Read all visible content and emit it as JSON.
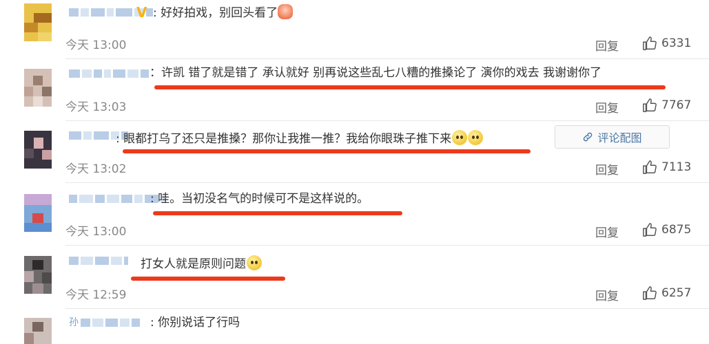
{
  "colors": {
    "underline": "#ee3a1c",
    "link": "#4c77a8",
    "vip": "#f6b417"
  },
  "reply_label": "回复",
  "comments": [
    {
      "text": ":  好好拍戏，别回头看了",
      "time": "今天 13:00",
      "likes": "6331",
      "vip": "V"
    },
    {
      "text": "：许凯 错了就是错了 承认就好 别再说这些乱七八糟的推搡论了 演你的戏去 我谢谢你了",
      "time": "今天 13:03",
      "likes": "7767"
    },
    {
      "text": ":  眼都打乌了还只是推搡？那你让我推一推？我给你眼珠子推下来",
      "time": "今天 13:02",
      "likes": "7113",
      "pic_button": "评论配图"
    },
    {
      "text": ":  哇。当初没名气的时候可不是这样说的。",
      "time": "今天 13:00",
      "likes": "6875"
    },
    {
      "text": "打女人就是原则问题",
      "time": "今天 12:59",
      "likes": "6257"
    },
    {
      "text": ":  你别说话了行吗",
      "name_char": "孙"
    }
  ]
}
